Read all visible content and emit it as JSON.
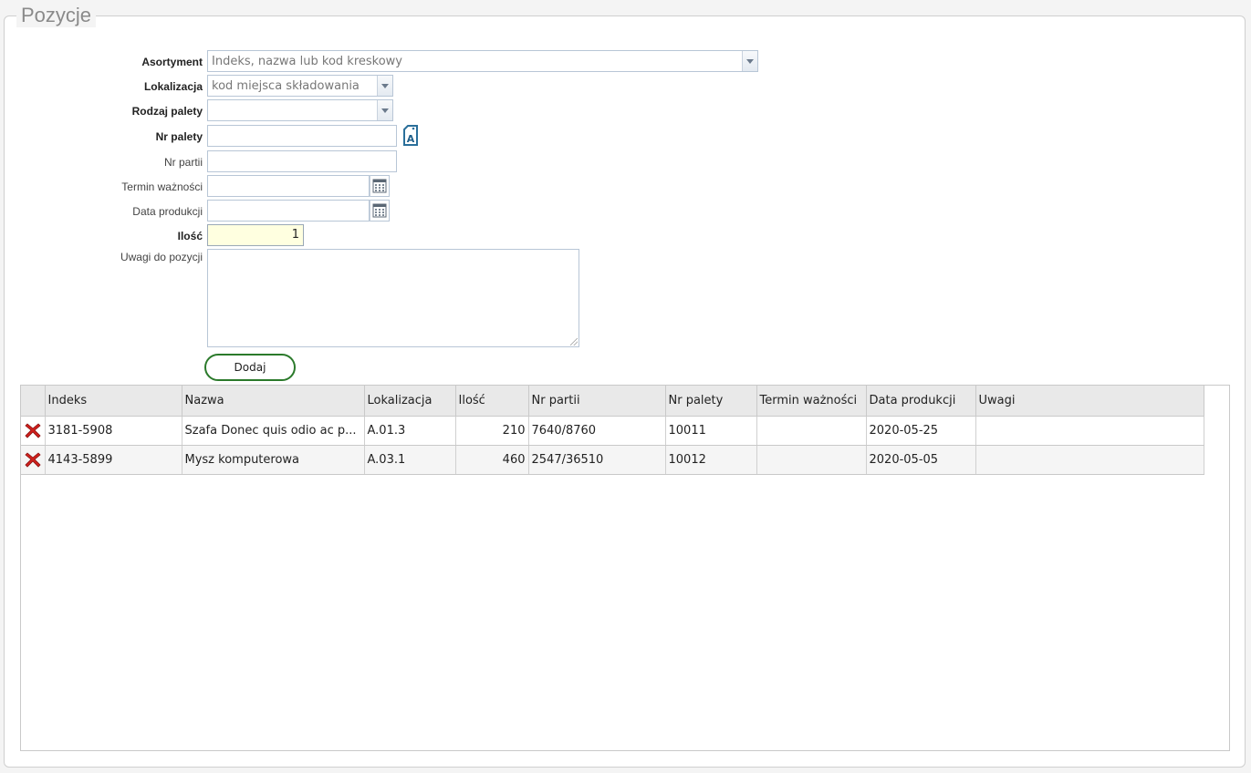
{
  "section": {
    "title": "Pozycje"
  },
  "form": {
    "asortyment": {
      "label": "Asortyment",
      "placeholder": "Indeks, nazwa lub kod kreskowy"
    },
    "lokalizacja": {
      "label": "Lokalizacja",
      "placeholder": "kod miejsca składowania"
    },
    "rodzaj_palety": {
      "label": "Rodzaj palety",
      "value": ""
    },
    "nr_palety": {
      "label": "Nr palety",
      "value": ""
    },
    "nr_partii": {
      "label": "Nr partii",
      "value": ""
    },
    "termin_waznosci": {
      "label": "Termin ważności",
      "value": ""
    },
    "data_produkcji": {
      "label": "Data produkcji",
      "value": ""
    },
    "ilosc": {
      "label": "Ilość",
      "value": "1"
    },
    "uwagi": {
      "label": "Uwagi do pozycji",
      "value": ""
    },
    "add_label": "Dodaj"
  },
  "table": {
    "columns": [
      "",
      "Indeks",
      "Nazwa",
      "Lokalizacja",
      "Ilość",
      "Nr partii",
      "Nr palety",
      "Termin ważności",
      "Data produkcji",
      "Uwagi"
    ],
    "rows": [
      {
        "indeks": "3181-5908",
        "nazwa": "Szafa Donec quis odio ac p...",
        "lokalizacja": "A.01.3",
        "ilosc": "210",
        "nr_partii": "7640/8760",
        "nr_palety": "10011",
        "termin": "",
        "data_produkcji": "2020-05-25",
        "uwagi": ""
      },
      {
        "indeks": "4143-5899",
        "nazwa": "Mysz komputerowa",
        "lokalizacja": "A.03.1",
        "ilosc": "460",
        "nr_partii": "2547/36510",
        "nr_palety": "10012",
        "termin": "",
        "data_produkcji": "2020-05-05",
        "uwagi": ""
      }
    ]
  },
  "icons": {
    "delete": "delete-x-icon",
    "pallet": "pallet-label-icon",
    "calendar": "calendar-icon"
  },
  "colors": {
    "button_border": "#2b7a2b",
    "delete_red": "#d0201c",
    "qty_bg": "#ffffe0"
  }
}
